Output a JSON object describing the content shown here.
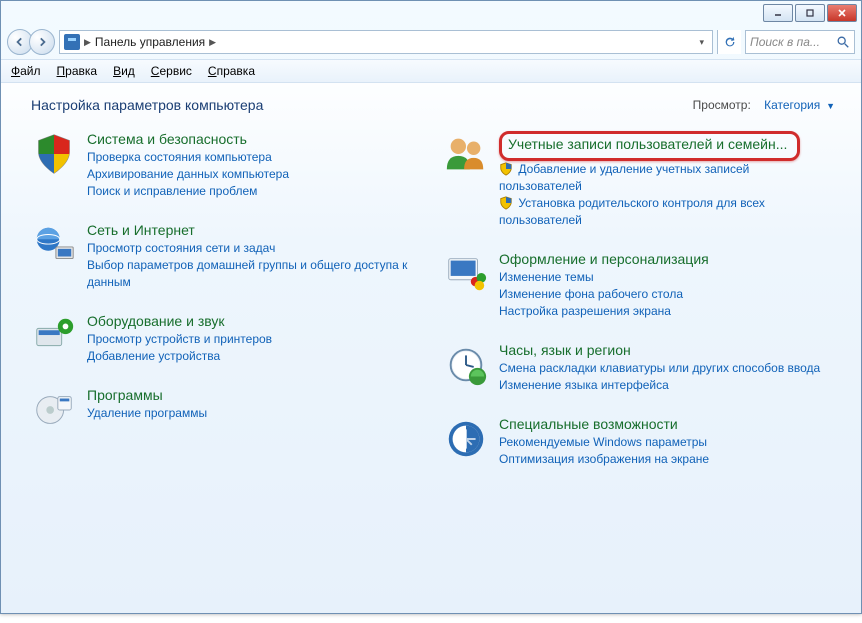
{
  "title_buttons": {
    "minimize": "–",
    "maximize": "▢",
    "close": "✕"
  },
  "breadcrumb": {
    "root": "Панель управления",
    "separators": [
      "▶",
      "▶"
    ]
  },
  "search": {
    "placeholder": "Поиск в па..."
  },
  "menu": {
    "file": "Файл",
    "edit": "Правка",
    "view": "Вид",
    "tools": "Сервис",
    "help": "Справка"
  },
  "header": {
    "title": "Настройка параметров компьютера",
    "view_label": "Просмотр:",
    "view_value": "Категория"
  },
  "categories": {
    "system": {
      "title": "Система и безопасность",
      "links": [
        "Проверка состояния компьютера",
        "Архивирование данных компьютера",
        "Поиск и исправление проблем"
      ]
    },
    "network": {
      "title": "Сеть и Интернет",
      "links": [
        "Просмотр состояния сети и задач",
        "Выбор параметров домашней группы и общего доступа к данным"
      ]
    },
    "hardware": {
      "title": "Оборудование и звук",
      "links": [
        "Просмотр устройств и принтеров",
        "Добавление устройства"
      ]
    },
    "programs": {
      "title": "Программы",
      "links": [
        "Удаление программы"
      ]
    },
    "users": {
      "title": "Учетные записи пользователей и семейн...",
      "links": [
        "Добавление и удаление учетных записей пользователей",
        "Установка родительского контроля для всех пользователей"
      ]
    },
    "appearance": {
      "title": "Оформление и персонализация",
      "links": [
        "Изменение темы",
        "Изменение фона рабочего стола",
        "Настройка разрешения экрана"
      ]
    },
    "clock": {
      "title": "Часы, язык и регион",
      "links": [
        "Смена раскладки клавиатуры или других способов ввода",
        "Изменение языка интерфейса"
      ]
    },
    "access": {
      "title": "Специальные возможности",
      "links": [
        "Рекомендуемые Windows параметры",
        "Оптимизация изображения на экране"
      ]
    }
  }
}
